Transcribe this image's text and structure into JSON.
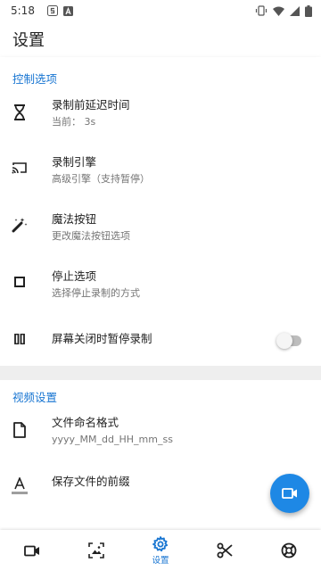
{
  "statusbar": {
    "time": "5:18"
  },
  "appbar": {
    "title": "设置"
  },
  "sections": {
    "control": "控制选项",
    "video": "视频设置"
  },
  "items": {
    "delay": {
      "title": "录制前延迟时间",
      "sub": "当前：  3s",
      "icon": "hourglass-icon"
    },
    "engine": {
      "title": "录制引擎",
      "sub": "高级引擎（支持暂停）",
      "icon": "cast-icon"
    },
    "magic": {
      "title": "魔法按钮",
      "sub": "更改魔法按钮选项",
      "icon": "magic-wand-icon"
    },
    "stop": {
      "title": "停止选项",
      "sub": "选择停止录制的方式",
      "icon": "stop-icon"
    },
    "screen_off": {
      "title": "屏幕关闭时暂停录制",
      "icon": "pause-icon",
      "toggle_on": false
    },
    "filename": {
      "title": "文件命名格式",
      "sub": "yyyy_MM_dd_HH_mm_ss",
      "icon": "file-icon"
    },
    "prefix": {
      "title": "保存文件的前缀",
      "icon": "text-format-icon"
    }
  },
  "bottomnav": {
    "active_label": "设置",
    "items": [
      "video-camera-icon",
      "image-icon",
      "settings-icon",
      "scissors-icon",
      "support-icon"
    ]
  },
  "colors": {
    "accent": "#1976d2",
    "fab": "#1e88e5"
  }
}
